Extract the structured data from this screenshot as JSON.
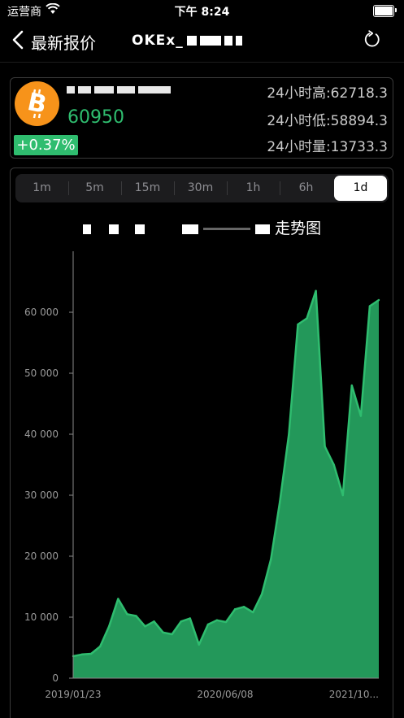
{
  "status_bar": {
    "carrier": "运营商",
    "time": "下午 8:24"
  },
  "nav": {
    "title": "最新报价",
    "pair": "OKEx_"
  },
  "coin": {
    "price": "60950",
    "change": "+0.37%",
    "high_label": "24小时高:62718.3",
    "low_label": "24小时低:58894.3",
    "volume_label": "24小时量:13733.3"
  },
  "intervals": [
    "1m",
    "5m",
    "15m",
    "30m",
    "1h",
    "6h",
    "1d"
  ],
  "selected_interval": "1d",
  "chart_title_suffix": "走势图",
  "colors": {
    "accent_green": "#2fbd6f",
    "fill_green": "#23985a",
    "bitcoin_orange": "#f7931a"
  },
  "chart_data": {
    "type": "area",
    "title": "",
    "xlabel": "",
    "ylabel": "",
    "ylim": [
      0,
      70000
    ],
    "y_ticks": [
      0,
      10000,
      20000,
      30000,
      40000,
      50000,
      60000
    ],
    "y_tick_labels": [
      "0",
      "10 000",
      "20 000",
      "30 000",
      "40 000",
      "50 000",
      "60 000"
    ],
    "x_tick_labels": [
      "2019/01/23",
      "2020/06/08",
      "2021/10..."
    ],
    "x": [
      "2019-01",
      "2019-02",
      "2019-03",
      "2019-04",
      "2019-05",
      "2019-06",
      "2019-07",
      "2019-08",
      "2019-09",
      "2019-10",
      "2019-11",
      "2019-12",
      "2020-01",
      "2020-02",
      "2020-03",
      "2020-04",
      "2020-05",
      "2020-06",
      "2020-07",
      "2020-08",
      "2020-09",
      "2020-10",
      "2020-11",
      "2020-12",
      "2021-01",
      "2021-02",
      "2021-03",
      "2021-04",
      "2021-05",
      "2021-06",
      "2021-07",
      "2021-08",
      "2021-09",
      "2021-10",
      "2021-11"
    ],
    "series": [
      {
        "values": [
          3600,
          3900,
          4000,
          5200,
          8500,
          13000,
          10500,
          10200,
          8500,
          9300,
          7500,
          7200,
          9300,
          9800,
          5500,
          8800,
          9500,
          9200,
          11300,
          11700,
          10800,
          13800,
          19500,
          29000,
          40000,
          58000,
          59000,
          63500,
          38000,
          35000,
          30000,
          48000,
          43000,
          61000,
          62000
        ]
      }
    ]
  }
}
